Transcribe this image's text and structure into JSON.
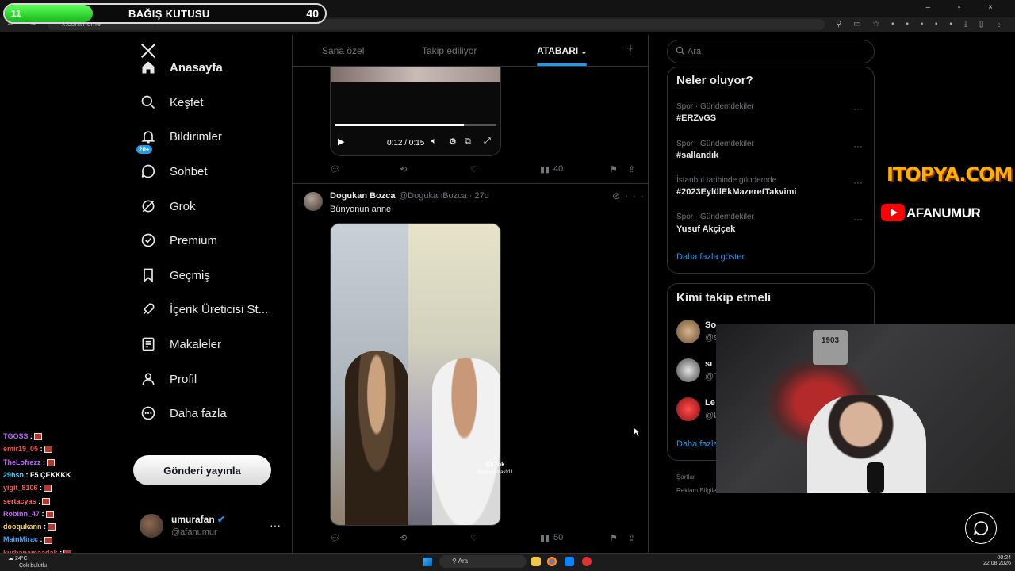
{
  "browser": {
    "url": "x.com/home",
    "tab_close": "×",
    "tab_new": "+"
  },
  "donation_bar": {
    "current": "11",
    "title": "BAĞIŞ KUTUSU",
    "goal": "40",
    "progress_fraction": 0.275
  },
  "leftnav": {
    "items": [
      {
        "label": "Anasayfa",
        "icon": "home-icon"
      },
      {
        "label": "Keşfet",
        "icon": "search-icon"
      },
      {
        "label": "Bildirimler",
        "icon": "bell-icon"
      },
      {
        "label": "Sohbet",
        "icon": "chat-icon"
      },
      {
        "label": "Grok",
        "icon": "grok-icon"
      },
      {
        "label": "Premium",
        "icon": "verified-icon"
      },
      {
        "label": "Geçmiş",
        "icon": "bookmark-icon"
      },
      {
        "label": "İçerik Üreticisi St...",
        "icon": "rocket-icon"
      },
      {
        "label": "Makaleler",
        "icon": "article-icon"
      },
      {
        "label": "Profil",
        "icon": "person-icon"
      },
      {
        "label": "Daha fazla",
        "icon": "more-circle-icon"
      }
    ],
    "notif_badge": "20+",
    "post_button": "Gönderi yayınla",
    "profile": {
      "name": "umurafan",
      "handle": "@afanumur",
      "more": "···"
    }
  },
  "main": {
    "tabs": [
      "Sana özel",
      "Takip ediliyor",
      "ATABARI"
    ],
    "tab_plus": "+",
    "video1": {
      "time": "0:12 / 0:15",
      "progress_fraction": 0.8
    },
    "tweet1_actions": {
      "views": "40"
    },
    "tweet2": {
      "name": "Dogukan Bozca",
      "handle": "@DogukanBozca · 27d",
      "text": "Bünyonun anne",
      "views": "50",
      "tiktok": "TikTok",
      "tiktok_handle": "@aykutelmas911"
    }
  },
  "sidebar": {
    "search_placeholder": "Ara",
    "trends_title": "Neler oluyor?",
    "trends": [
      {
        "category": "Spor · Gündemdekiler",
        "tag": "#ERZvGS"
      },
      {
        "category": "Spor · Gündemdekiler",
        "tag": "#sallandık"
      },
      {
        "category": "İstanbul tarihinde gündemde",
        "tag": "#2023EylülEkMazeretTakvimi"
      },
      {
        "category": "Spor · Gündemdekiler",
        "tag": "Yusuf Akçiçek"
      }
    ],
    "show_more": "Daha fazla göster",
    "who_title": "Kimi takip etmeli",
    "who": [
      {
        "name": "So",
        "handle": "@s"
      },
      {
        "name": "sı",
        "handle": "@T"
      },
      {
        "name": "Le",
        "handle": "@L"
      }
    ],
    "who_more": "Daha fazla",
    "footer1": "Şartlar",
    "footer2": "Reklam Bilgileri"
  },
  "overlays": {
    "sponsor": "ITOPYA.COM",
    "youtube": "AFANUMUR",
    "webcam_sign": "1903"
  },
  "chat": [
    {
      "user": "TGOSS",
      "msg": ":",
      "color": "#b266ff"
    },
    {
      "user": "emir19_05",
      "msg": ":",
      "color": "#ff4d4d"
    },
    {
      "user": "TheLofrezz",
      "msg": ":",
      "color": "#c266ff"
    },
    {
      "user": "29hsn",
      "msg": ": F5 ÇEKKKK",
      "color": "#4dd2ff"
    },
    {
      "user": "yigit_8106",
      "msg": ":",
      "color": "#ff5c5c"
    },
    {
      "user": "sertacyas",
      "msg": ":",
      "color": "#ff6b6b"
    },
    {
      "user": "Robinn_47",
      "msg": ":",
      "color": "#c266ff"
    },
    {
      "user": "dooqukann",
      "msg": ":",
      "color": "#ffcc4d"
    },
    {
      "user": "MainMirac",
      "msg": ":",
      "color": "#4da6ff"
    },
    {
      "user": "kurbanamaadak",
      "msg": ":",
      "color": "#ff4d4d"
    }
  ],
  "taskbar": {
    "weather_temp": "24°C",
    "weather_desc": "Çok bulutlu",
    "search": "Ara",
    "time": "00:24",
    "date": "22.08.2026"
  }
}
